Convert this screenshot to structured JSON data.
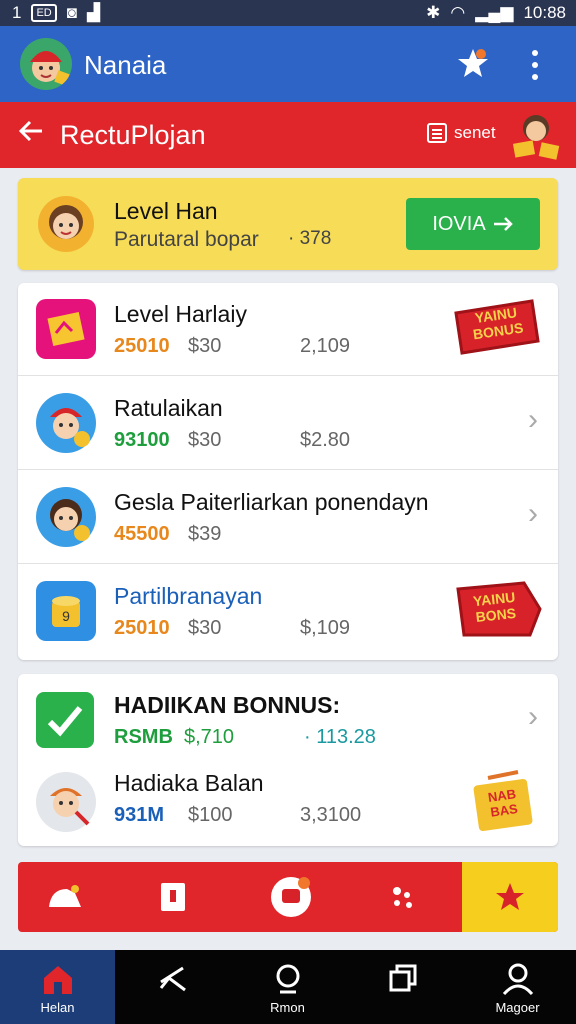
{
  "status_bar": {
    "left_text": "1",
    "time": "10:88"
  },
  "app_bar": {
    "title": "Nanaia",
    "colors": {
      "blue": "#2e64c5"
    }
  },
  "sub_bar": {
    "title": "RectuPlojan",
    "action_label": "senet",
    "color": "#e0252b"
  },
  "hero": {
    "title": "Level Han",
    "subtitle": "Parutaral bopar",
    "value": "· 378",
    "button_label": "IOVIA",
    "color": "#f6dc57"
  },
  "list": [
    {
      "name": "Level Harlaiy",
      "v1": "25010",
      "v2": "$30",
      "v3": "2,109",
      "v1_color": "#e8871c",
      "badge": "YAINU BONUS"
    },
    {
      "name": "Ratulaikan",
      "v1": "93100",
      "v2": "$30",
      "v3": "$2.80",
      "v1_color": "#1e9e3c"
    },
    {
      "name": "Gesla Paiterliarkan ponendayn",
      "v1": "45500",
      "v2": "$39",
      "v3": "",
      "v1_color": "#e8871c"
    },
    {
      "name": "Partilbranayan",
      "v1": "25010",
      "v2": "$30",
      "v3": "$,109",
      "v1_color": "#e8871c",
      "badge": "YAINU BONS"
    }
  ],
  "bonus_card": {
    "title": "HADIIKAN BONNUS:",
    "rows": [
      {
        "v1": "RSMB",
        "v2": "$,710",
        "v3": "· 113.28"
      },
      {
        "name": "Hadiaka Balan",
        "v1": "931M",
        "v2": "$100",
        "v3": "3,3100",
        "box_label": "NAB BAS"
      }
    ]
  },
  "bottom_tabs": [
    {
      "label": "Helan",
      "icon": "home-icon"
    },
    {
      "label": "",
      "icon": "share-icon"
    },
    {
      "label": "Rmon",
      "icon": "search-icon"
    },
    {
      "label": "",
      "icon": "windows-icon"
    },
    {
      "label": "Magoer",
      "icon": "profile-icon"
    }
  ]
}
